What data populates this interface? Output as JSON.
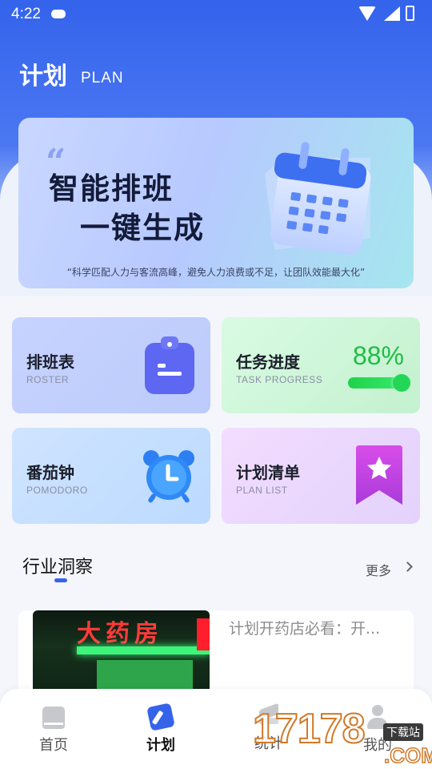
{
  "status_bar": {
    "time": "4:22"
  },
  "header": {
    "title": "计划",
    "subtitle": "PLAN"
  },
  "banner": {
    "quote_mark": "“",
    "line1": "智能排班",
    "line2": "一键生成",
    "slogan": "“科学匹配人力与客流高峰，避免人力浪费或不足，让团队效能最大化”"
  },
  "cards": {
    "roster": {
      "title": "排班表",
      "subtitle": "ROSTER"
    },
    "task": {
      "title": "任务进度",
      "subtitle": "TASK PROGRESS",
      "percent_label": "88%",
      "progress": 0.88
    },
    "pomodoro": {
      "title": "番茄钟",
      "subtitle": "POMODORO"
    },
    "planlist": {
      "title": "计划清单",
      "subtitle": "PLAN LIST"
    }
  },
  "insights": {
    "title": "行业洞察",
    "more_label": "更多",
    "articles": [
      {
        "title": "计划开药店必看：开...",
        "thumb_sign": "大药房"
      }
    ]
  },
  "bottom_nav": {
    "items": [
      {
        "label": "首页",
        "icon": "home-icon",
        "active": false
      },
      {
        "label": "计划",
        "icon": "plan-icon",
        "active": true
      },
      {
        "label": "统计",
        "icon": "stats-icon",
        "active": false
      },
      {
        "label": "我的",
        "icon": "profile-icon",
        "active": false
      }
    ]
  },
  "watermark": {
    "text": "17178",
    "tag": "下载站",
    "suffix": ".COM"
  },
  "colors": {
    "accent": "#3563ea",
    "progress": "#1fbd44"
  }
}
